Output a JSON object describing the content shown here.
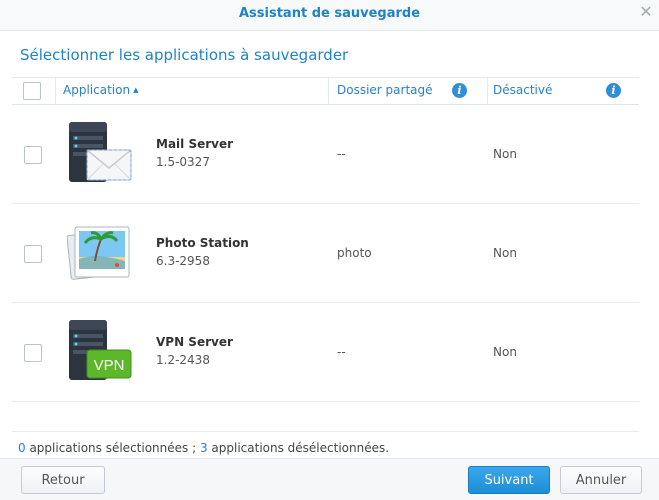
{
  "window": {
    "title": "Assistant de sauvegarde"
  },
  "heading": "Sélectionner les applications à sauvegarder",
  "columns": {
    "application": "Application",
    "shared_folder": "Dossier partagé",
    "disabled": "Désactivé"
  },
  "rows": [
    {
      "name": "Mail Server",
      "version": "1.5-0327",
      "shared_folder": "--",
      "disabled": "Non",
      "icon": "mail-server-icon"
    },
    {
      "name": "Photo Station",
      "version": "6.3-2958",
      "shared_folder": "photo",
      "disabled": "Non",
      "icon": "photo-station-icon"
    },
    {
      "name": "VPN Server",
      "version": "1.2-2438",
      "shared_folder": "--",
      "disabled": "Non",
      "icon": "vpn-server-icon",
      "badge": "VPN"
    }
  ],
  "status": {
    "selected_count": "0",
    "selected_text": " applications sélectionnées ; ",
    "deselected_count": "3",
    "deselected_text": " applications désélectionnées."
  },
  "buttons": {
    "back": "Retour",
    "next": "Suivant",
    "cancel": "Annuler"
  },
  "colors": {
    "accent": "#1f83c7",
    "primary_button": "#2196e3",
    "vpn_badge": "#5cb82a"
  }
}
